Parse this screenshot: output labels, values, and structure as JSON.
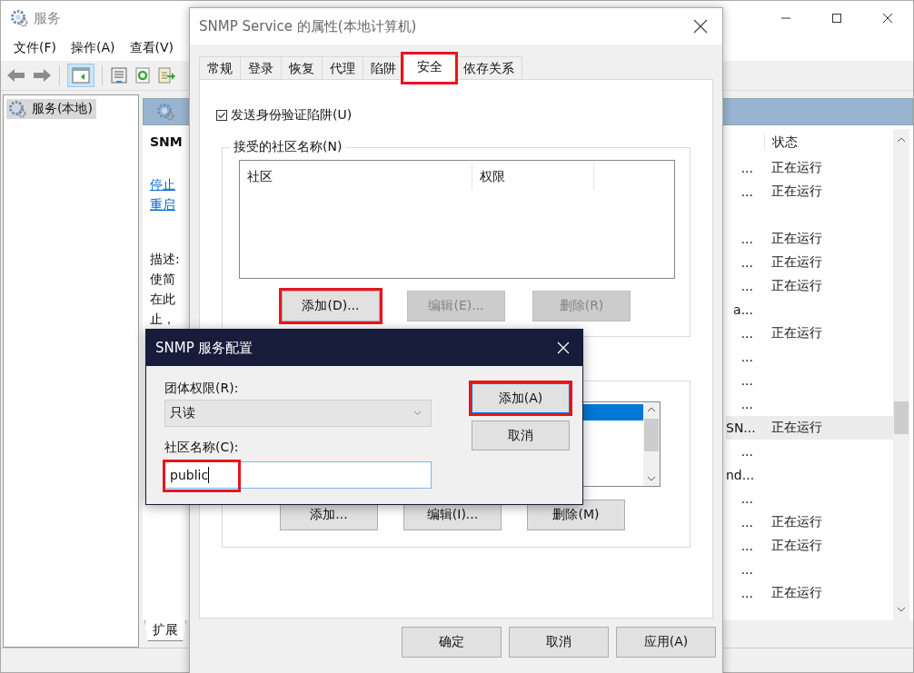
{
  "main_window": {
    "title": "服务",
    "menu": [
      "文件(F)",
      "操作(A)",
      "查看(V)"
    ],
    "tree": [
      {
        "label": "服务(本地)",
        "selected": true
      }
    ],
    "detail": {
      "service_name": "SNM",
      "links": [
        "停止",
        "重启"
      ],
      "description_label": "描述:",
      "description_lines": [
        "使简",
        "在此",
        "止，"
      ]
    },
    "list": {
      "status_header": "状态",
      "rows": [
        {
          "name": "...",
          "status": "正在运行",
          "selected": false
        },
        {
          "name": "...",
          "status": "正在运行",
          "selected": false
        },
        {
          "selected": false
        },
        {
          "name": "...",
          "status": "正在运行",
          "selected": false
        },
        {
          "name": "...",
          "status": "正在运行",
          "selected": false
        },
        {
          "name": "...",
          "status": "正在运行",
          "selected": false
        },
        {
          "name": "a...",
          "selected": false
        },
        {
          "name": "...",
          "status": "正在运行",
          "selected": false
        },
        {
          "name": "...",
          "selected": false
        },
        {
          "name": "...",
          "selected": false
        },
        {
          "name": "...",
          "selected": false
        },
        {
          "name": "SN...",
          "status": "正在运行",
          "selected": true
        },
        {
          "name": "...",
          "selected": false
        },
        {
          "name": "nd...",
          "selected": false
        },
        {
          "name": "...",
          "selected": false
        },
        {
          "name": "...",
          "status": "正在运行",
          "selected": false
        },
        {
          "name": "...",
          "status": "正在运行",
          "selected": false
        },
        {
          "name": "...",
          "selected": false
        },
        {
          "name": "...",
          "status": "正在运行",
          "selected": false
        }
      ]
    },
    "bottom_tab": "扩展"
  },
  "properties_dialog": {
    "title": "SNMP Service 的属性(本地计算机)",
    "tabs": [
      {
        "label": "常规",
        "selected": false,
        "highlighted": false
      },
      {
        "label": "登录",
        "selected": false,
        "highlighted": false
      },
      {
        "label": "恢复",
        "selected": false,
        "highlighted": false
      },
      {
        "label": "代理",
        "selected": false,
        "highlighted": false
      },
      {
        "label": "陷阱",
        "selected": false,
        "highlighted": false
      },
      {
        "label": "安全",
        "selected": true,
        "highlighted": true
      },
      {
        "label": "依存关系",
        "selected": false,
        "highlighted": false
      }
    ],
    "send_auth_trap": {
      "label": "发送身份验证陷阱(U)",
      "checked": true
    },
    "accepted_communities": {
      "title": "接受的社区名称(N)",
      "columns": [
        "社区",
        "权限"
      ],
      "buttons": [
        {
          "label": "添加(D)...",
          "disabled": false,
          "highlighted": true
        },
        {
          "label": "编辑(E)...",
          "disabled": true,
          "highlighted": false
        },
        {
          "label": "删除(R)",
          "disabled": true,
          "highlighted": false
        }
      ]
    },
    "hosts": {
      "buttons": [
        {
          "label": "添加...",
          "disabled": false,
          "highlighted": false
        },
        {
          "label": "编辑(I)...",
          "disabled": false,
          "highlighted": false
        },
        {
          "label": "删除(M)",
          "disabled": false,
          "highlighted": false
        }
      ]
    },
    "footer_buttons": [
      {
        "label": "确定",
        "disabled": false
      },
      {
        "label": "取消",
        "disabled": false
      },
      {
        "label": "应用(A)",
        "disabled": false
      }
    ]
  },
  "config_dialog": {
    "title": "SNMP 服务配置",
    "rights": {
      "label": "团体权限(R):",
      "value": "只读"
    },
    "community": {
      "label": "社区名称(C):",
      "value": "public",
      "highlighted": true
    },
    "buttons": [
      {
        "label": "添加(A)",
        "default": true,
        "highlighted": true
      },
      {
        "label": "取消",
        "default": false,
        "highlighted": false
      }
    ]
  }
}
